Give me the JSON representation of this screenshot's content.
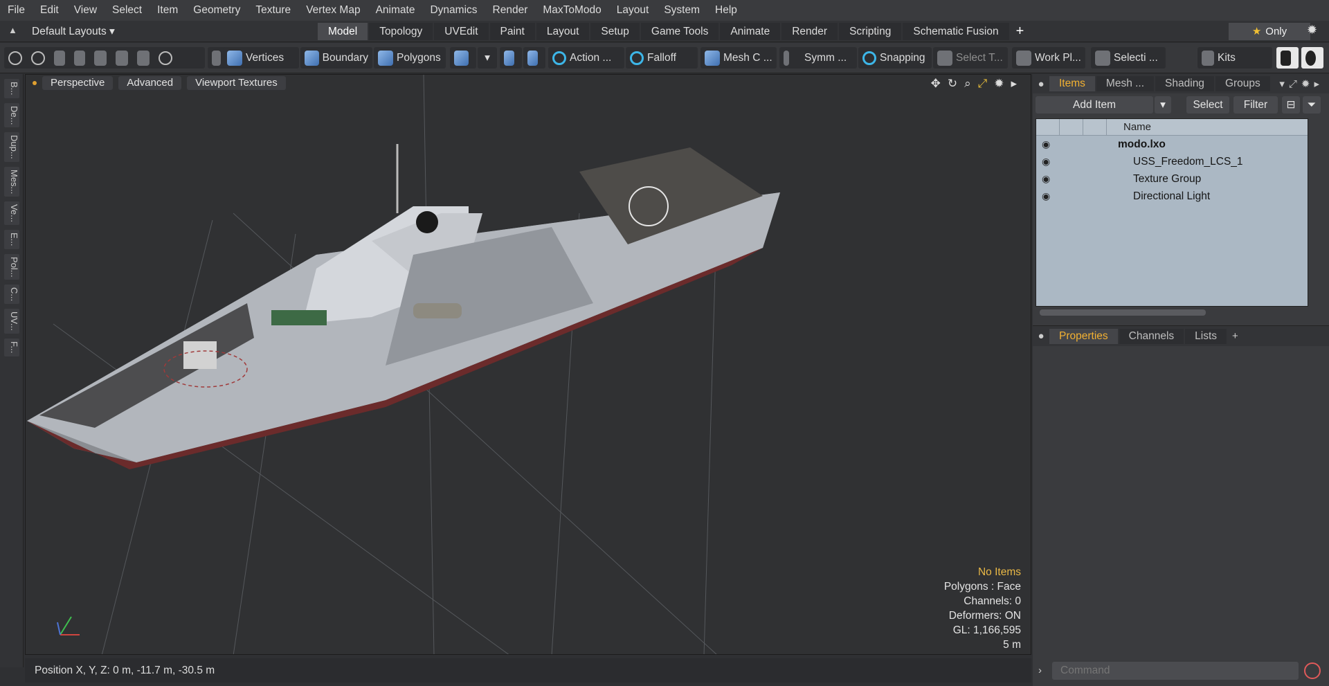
{
  "menu": [
    "File",
    "Edit",
    "View",
    "Select",
    "Item",
    "Geometry",
    "Texture",
    "Vertex Map",
    "Animate",
    "Dynamics",
    "Render",
    "MaxToModo",
    "Layout",
    "System",
    "Help"
  ],
  "layout": {
    "layouts_label": "Default Layouts ▾",
    "tabs": [
      "Model",
      "Topology",
      "UVEdit",
      "Paint",
      "Layout",
      "Setup",
      "Game Tools",
      "Animate",
      "Render",
      "Scripting",
      "Schematic Fusion"
    ],
    "active_tab": "Model",
    "add": "+",
    "only_label": "Only"
  },
  "toolbar": {
    "vertices": "Vertices",
    "boundary": "Boundary",
    "polygons": "Polygons",
    "action": "Action ...",
    "falloff": "Falloff",
    "mesh_c": "Mesh C ...",
    "symm": "Symm ...",
    "snapping": "Snapping",
    "select_t": "Select T...",
    "work_pl": "Work Pl...",
    "selecti": "Selecti ...",
    "kits": "Kits"
  },
  "left_strip": [
    "B...",
    "De...",
    "Dup...",
    "Mes...",
    "Ve...",
    "E...",
    "Pol...",
    "C...",
    "UV...",
    "F..."
  ],
  "viewport": {
    "tabs": [
      "Perspective",
      "Advanced",
      "Viewport Textures"
    ],
    "stats": {
      "no_items": "No Items",
      "polygons": "Polygons : Face",
      "channels": "Channels: 0",
      "deformers": "Deformers: ON",
      "gl": "GL: 1,166,595",
      "scale": "5 m"
    }
  },
  "status": "Position X, Y, Z:   0 m, -11.7 m, -30.5 m",
  "items_panel": {
    "tabs": [
      "Items",
      "Mesh ...",
      "Shading",
      "Groups"
    ],
    "active": "Items",
    "add_item": "Add Item",
    "select": "Select",
    "filter": "Filter",
    "column_name": "Name",
    "tree": [
      {
        "label": "modo.lxo",
        "indent": 0,
        "bold": true
      },
      {
        "label": "USS_Freedom_LCS_1",
        "indent": 1,
        "bold": false
      },
      {
        "label": "Texture Group",
        "indent": 1,
        "bold": false
      },
      {
        "label": "Directional Light",
        "indent": 1,
        "bold": false
      }
    ]
  },
  "properties_panel": {
    "tabs": [
      "Properties",
      "Channels",
      "Lists"
    ],
    "active": "Properties",
    "add": "+"
  },
  "command_placeholder": "Command"
}
